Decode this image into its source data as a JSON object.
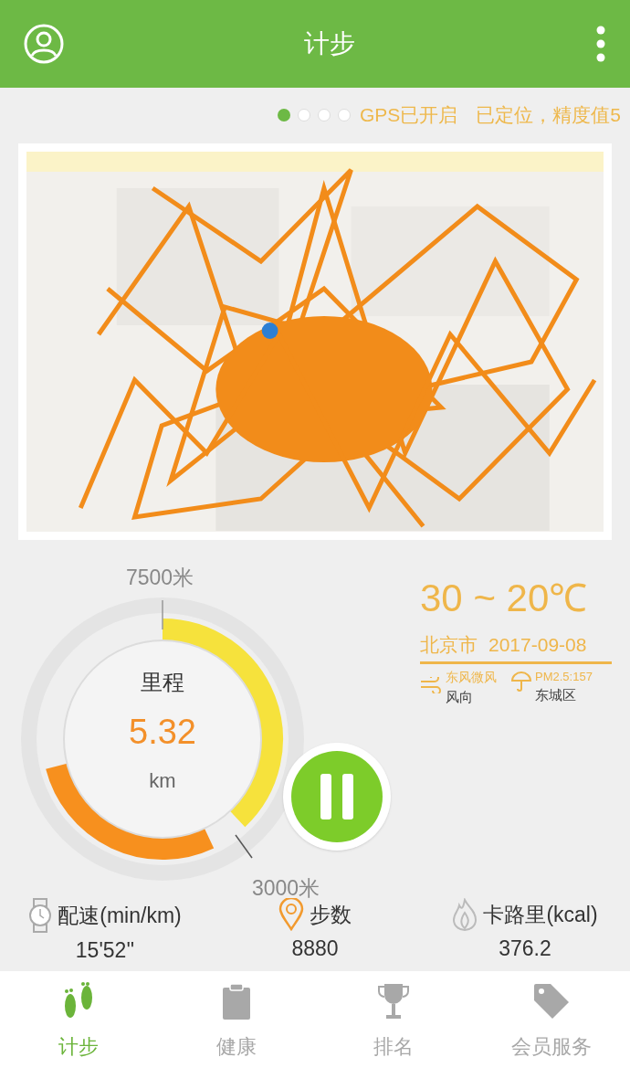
{
  "header": {
    "title": "计步"
  },
  "page_dots": [
    {
      "selected": true
    },
    {
      "selected": false
    },
    {
      "selected": false
    },
    {
      "selected": false
    }
  ],
  "gps_status": "GPS已开启",
  "location_status": "已定位，精度值5",
  "gauge": {
    "top_label": "7500米",
    "bottom_label": "3000米",
    "title": "里程",
    "value": "5.32",
    "unit": "km"
  },
  "weather": {
    "temperature": "30 ~ 20℃",
    "city": "北京市",
    "date": "2017-09-08",
    "wind_value": "东风微风",
    "wind_label": "风向",
    "air_value": "PM2.5:157",
    "district": "东城区"
  },
  "pause_button": {
    "paused": false
  },
  "stats": [
    {
      "kind": "pace",
      "label": "配速(min/km)",
      "value": "15'52''"
    },
    {
      "kind": "steps",
      "label": "步数",
      "value": "8880"
    },
    {
      "kind": "calories",
      "label": "卡路里(kcal)",
      "value": "376.2"
    }
  ],
  "tabs": [
    {
      "kind": "steps",
      "label": "计步",
      "selected": true
    },
    {
      "kind": "health",
      "label": "健康",
      "selected": false
    },
    {
      "kind": "ranking",
      "label": "排名",
      "selected": false
    },
    {
      "kind": "member",
      "label": "会员服务",
      "selected": false
    }
  ]
}
